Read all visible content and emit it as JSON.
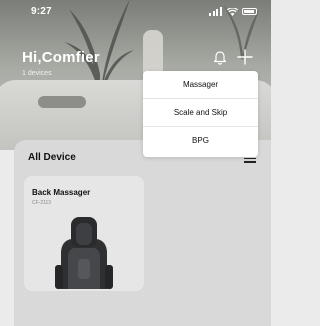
{
  "status_bar": {
    "time": "9:27"
  },
  "header": {
    "greeting": "Hi,Comfier",
    "device_count": "1 devices",
    "icons": [
      "bell-icon",
      "plus-icon"
    ]
  },
  "dropdown_menu": {
    "items": [
      {
        "label": "Massager"
      },
      {
        "label": "Scale and Skip"
      },
      {
        "label": "BPG"
      }
    ]
  },
  "devices_panel": {
    "title": "All Device",
    "cards": [
      {
        "name": "Back Massager",
        "model": "CF-2113"
      }
    ]
  },
  "colors": {
    "hero_dark": "#7b7e78",
    "panel_bg": "#d9d9d9",
    "card_bg": "#e6e6e6",
    "menu_bg": "#ffffff"
  }
}
